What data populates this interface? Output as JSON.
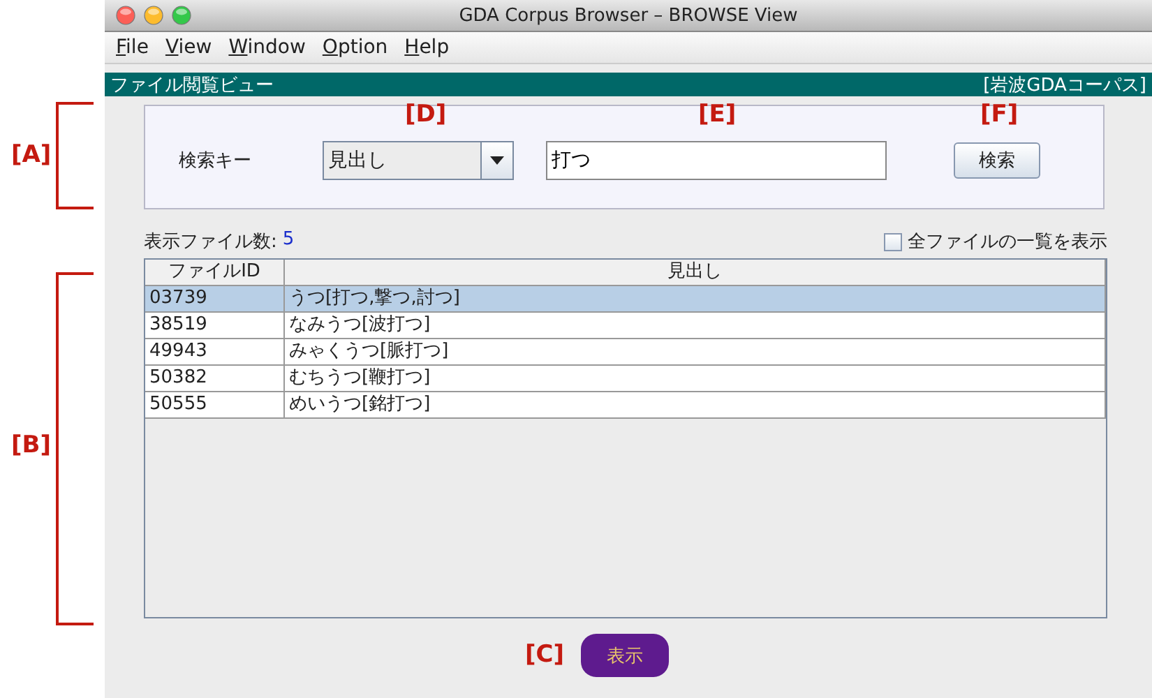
{
  "window": {
    "title": "GDA Corpus Browser – BROWSE View"
  },
  "menu": [
    {
      "label": "File"
    },
    {
      "label": "View"
    },
    {
      "label": "Window"
    },
    {
      "label": "Option"
    },
    {
      "label": "Help"
    }
  ],
  "header": {
    "title": "ファイル閲覧ビュー",
    "corpus": "[岩波GDAコーパス]"
  },
  "search": {
    "label": "検索キー",
    "key_select": "見出し",
    "query": "打つ",
    "button": "検索"
  },
  "file_count": {
    "label": "表示ファイル数:",
    "value": "5"
  },
  "show_all": {
    "label": "全ファイルの一覧を表示",
    "checked": false
  },
  "table": {
    "columns": [
      "ファイルID",
      "見出し"
    ],
    "rows": [
      {
        "cells": [
          "03739",
          "うつ[打つ,撃つ,討つ]"
        ],
        "selected": true
      },
      {
        "cells": [
          "38519",
          "なみうつ[波打つ]"
        ],
        "selected": false
      },
      {
        "cells": [
          "49943",
          "みゃくうつ[脈打つ]"
        ],
        "selected": false
      },
      {
        "cells": [
          "50382",
          "むちうつ[鞭打つ]"
        ],
        "selected": false
      },
      {
        "cells": [
          "50555",
          "めいうつ[銘打つ]"
        ],
        "selected": false
      }
    ]
  },
  "display_button": "表示",
  "annotations": [
    {
      "label": "[A]",
      "kind": "bracket"
    },
    {
      "label": "[B]",
      "kind": "bracket"
    },
    {
      "label": "[C]",
      "kind": "tag"
    },
    {
      "label": "[D]",
      "kind": "tag"
    },
    {
      "label": "[E]",
      "kind": "tag"
    },
    {
      "label": "[F]",
      "kind": "tag"
    }
  ]
}
